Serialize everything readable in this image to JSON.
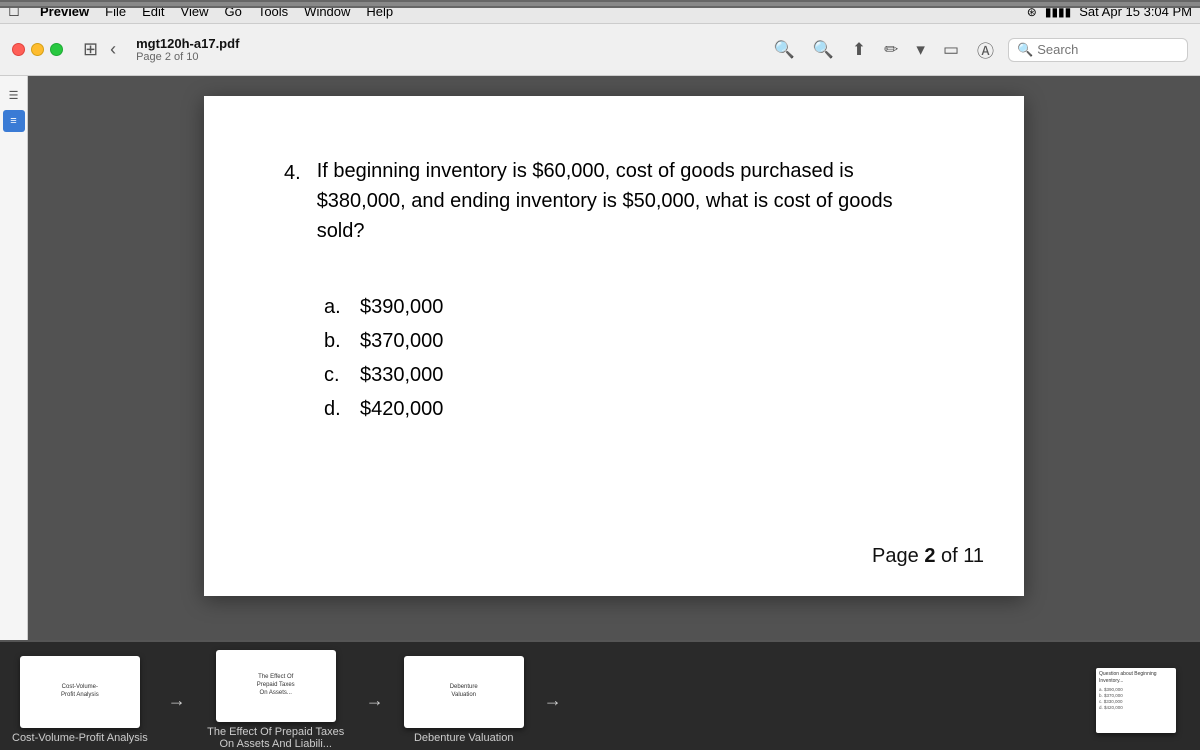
{
  "menubar": {
    "apple": "⌘",
    "items": [
      "Preview",
      "File",
      "Edit",
      "View",
      "Go",
      "Tools",
      "Window",
      "Help"
    ],
    "right": {
      "datetime": "Sat Apr 15  3:04 PM"
    }
  },
  "toolbar": {
    "doc_title": "mgt120h-a17.pdf",
    "doc_page": "Page 2 of 10",
    "search_placeholder": "Search"
  },
  "pdf": {
    "question_number": "4.",
    "question_text": "If beginning inventory is $60,000, cost of goods purchased is $380,000, and ending inventory is $50,000, what is cost of goods sold?",
    "answers": [
      {
        "label": "a.",
        "value": "$390,000"
      },
      {
        "label": "b.",
        "value": "$370,000"
      },
      {
        "label": "c.",
        "value": "$330,000"
      },
      {
        "label": "d.",
        "value": "$420,000"
      }
    ],
    "page_indicator_prefix": "Page ",
    "page_indicator_num": "2",
    "page_indicator_suffix": " of 11"
  },
  "thumbnail_strip": {
    "items": [
      {
        "label": "Cost-Volume-Profit Analysis",
        "text": "Cost-Volume-\nProfit Analysis"
      },
      {
        "label": "The Effect Of Prepaid Taxes On Assets And Liabili...",
        "text": "The Effect Of\nPrepaid Taxes..."
      },
      {
        "label": "Debenture Valuation",
        "text": "Debenture\nValuation"
      }
    ],
    "arrow_char": "→"
  }
}
